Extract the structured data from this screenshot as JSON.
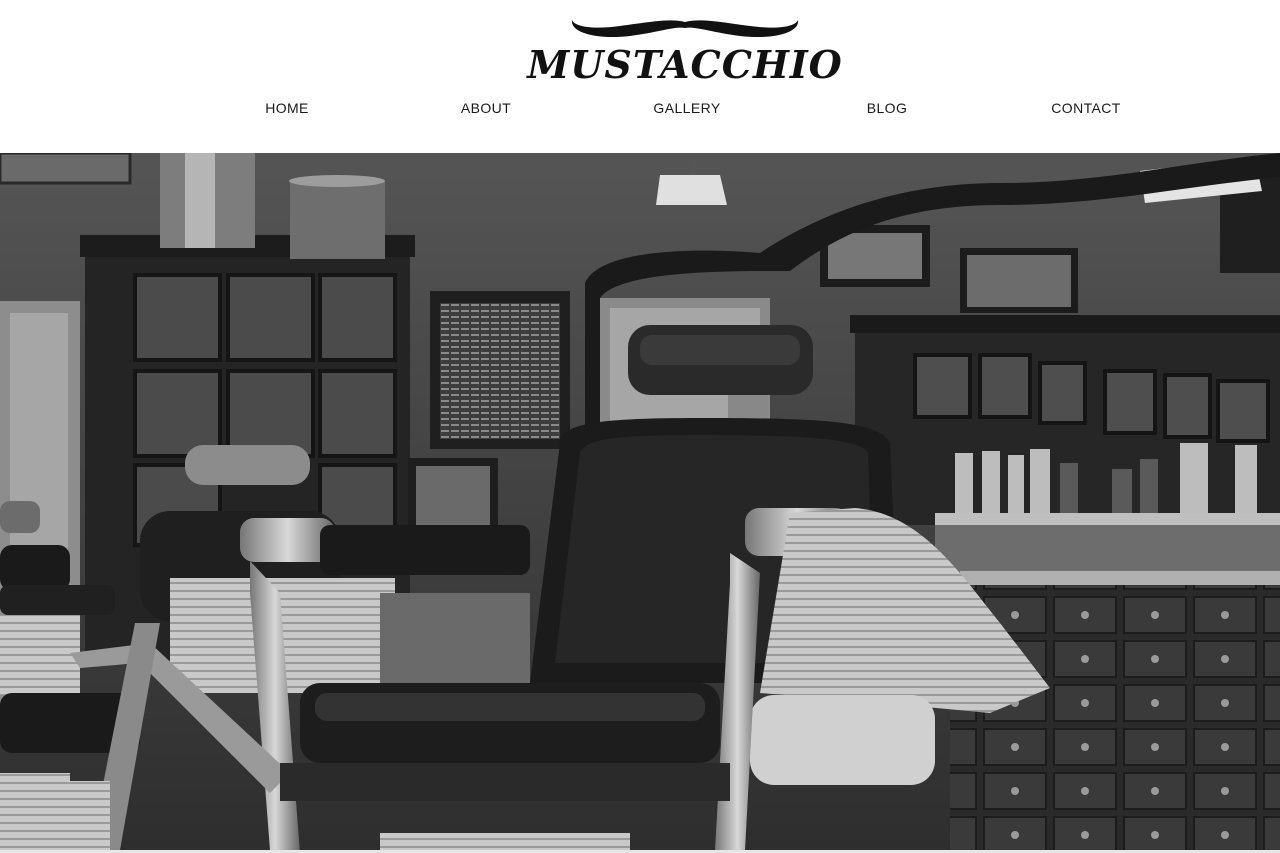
{
  "brand": {
    "name": "MUSTACCHIO",
    "logo_icon": "mustache-icon"
  },
  "nav": {
    "items": [
      {
        "label": "HOME"
      },
      {
        "label": "ABOUT"
      },
      {
        "label": "GALLERY"
      },
      {
        "label": "BLOG"
      },
      {
        "label": "CONTACT"
      }
    ]
  },
  "hero": {
    "image": "barbershop-interior-photo"
  },
  "colors": {
    "text": "#1a1a1a",
    "header_bg": "#ffffff",
    "hero_tone": "grayscale"
  }
}
